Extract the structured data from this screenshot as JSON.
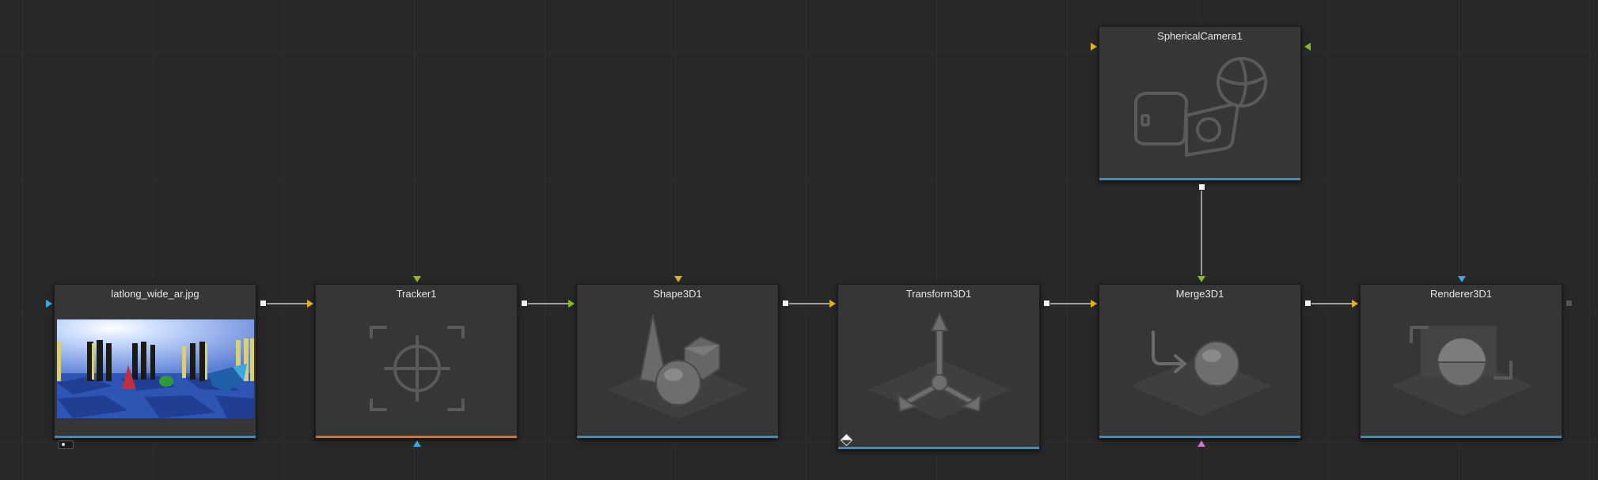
{
  "flow": {
    "nodes": [
      {
        "id": "loader",
        "title": "latlong_wide_ar.jpg"
      },
      {
        "id": "tracker",
        "title": "Tracker1"
      },
      {
        "id": "shape3d",
        "title": "Shape3D1"
      },
      {
        "id": "transform3d",
        "title": "Transform3D1"
      },
      {
        "id": "merge3d",
        "title": "Merge3D1"
      },
      {
        "id": "renderer3d",
        "title": "Renderer3D1"
      },
      {
        "id": "camera",
        "title": "SphericalCamera1"
      }
    ]
  },
  "colors": {
    "background": "#282828",
    "node_body": "#363636",
    "input_yellow": "#e0b020",
    "input_green": "#8ab820",
    "input_blue": "#3aa8e0",
    "input_magenta": "#d070d0",
    "bar_blue": "#3a8ec8",
    "bar_orange": "#e0701a",
    "wire": "#e8e8e8"
  },
  "icons": {
    "loader": "image-thumbnail",
    "tracker": "crosshair-tracker-icon",
    "shape3d": "cone-sphere-cube-icon",
    "transform3d": "3d-axes-icon",
    "merge3d": "merge-arrow-sphere-icon",
    "renderer3d": "render-frame-sphere-icon",
    "camera": "spherical-camera-icon"
  }
}
